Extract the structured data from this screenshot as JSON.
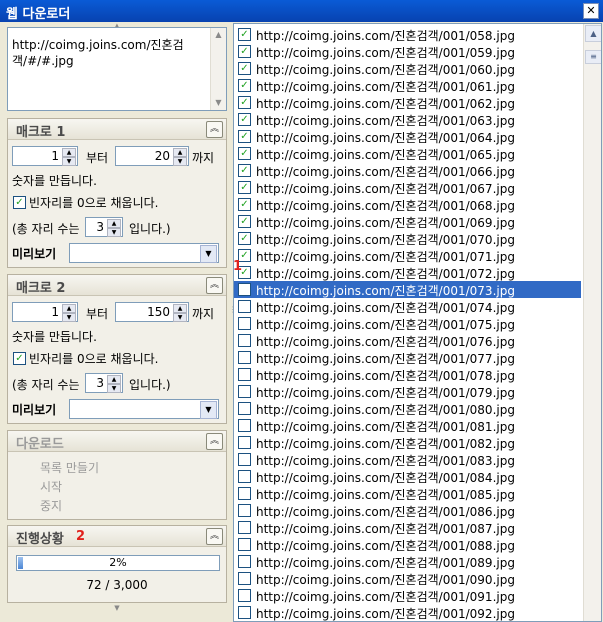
{
  "window": {
    "title": "웹 다운로더",
    "close_glyph": "✕"
  },
  "source": {
    "url_text": "http://coimg.joins.com/진혼검객/#/#.jpg"
  },
  "macro1": {
    "title": "매크로 1",
    "from_value": "1",
    "from_label": "부터",
    "to_value": "20",
    "to_label": "까지",
    "make_label": "숫자를 만듭니다.",
    "zero_fill_label": "빈자리를 0으로 채웁니다.",
    "digits_prefix": "(총 자리 수는",
    "digits_value": "3",
    "digits_suffix": "입니다.)",
    "preview_label": "미리보기"
  },
  "macro2": {
    "title": "매크로 2",
    "from_value": "1",
    "from_label": "부터",
    "to_value": "150",
    "to_label": "까지",
    "make_label": "숫자를 만듭니다.",
    "zero_fill_label": "빈자리를 0으로 채웁니다.",
    "digits_prefix": "(총 자리 수는",
    "digits_value": "3",
    "digits_suffix": "입니다.)",
    "preview_label": "미리보기"
  },
  "download": {
    "title": "다운로드",
    "items": [
      "목록 만들기",
      "시작",
      "중지"
    ]
  },
  "progress": {
    "title": "진행상황",
    "percent_text": "2%",
    "fraction": 0.024,
    "count_text": "72 / 3,000"
  },
  "markers": {
    "first": "1",
    "second": "2"
  },
  "list": {
    "items": [
      {
        "url": "http://coimg.joins.com/진혼검객/001/058.jpg",
        "checked": true
      },
      {
        "url": "http://coimg.joins.com/진혼검객/001/059.jpg",
        "checked": true
      },
      {
        "url": "http://coimg.joins.com/진혼검객/001/060.jpg",
        "checked": true
      },
      {
        "url": "http://coimg.joins.com/진혼검객/001/061.jpg",
        "checked": true
      },
      {
        "url": "http://coimg.joins.com/진혼검객/001/062.jpg",
        "checked": true
      },
      {
        "url": "http://coimg.joins.com/진혼검객/001/063.jpg",
        "checked": true
      },
      {
        "url": "http://coimg.joins.com/진혼검객/001/064.jpg",
        "checked": true
      },
      {
        "url": "http://coimg.joins.com/진혼검객/001/065.jpg",
        "checked": true
      },
      {
        "url": "http://coimg.joins.com/진혼검객/001/066.jpg",
        "checked": true
      },
      {
        "url": "http://coimg.joins.com/진혼검객/001/067.jpg",
        "checked": true
      },
      {
        "url": "http://coimg.joins.com/진혼검객/001/068.jpg",
        "checked": true
      },
      {
        "url": "http://coimg.joins.com/진혼검객/001/069.jpg",
        "checked": true
      },
      {
        "url": "http://coimg.joins.com/진혼검객/001/070.jpg",
        "checked": true
      },
      {
        "url": "http://coimg.joins.com/진혼검객/001/071.jpg",
        "checked": true
      },
      {
        "url": "http://coimg.joins.com/진혼검객/001/072.jpg",
        "checked": true
      },
      {
        "url": "http://coimg.joins.com/진혼검객/001/073.jpg",
        "checked": false,
        "selected": true
      },
      {
        "url": "http://coimg.joins.com/진혼검객/001/074.jpg",
        "checked": false
      },
      {
        "url": "http://coimg.joins.com/진혼검객/001/075.jpg",
        "checked": false
      },
      {
        "url": "http://coimg.joins.com/진혼검객/001/076.jpg",
        "checked": false
      },
      {
        "url": "http://coimg.joins.com/진혼검객/001/077.jpg",
        "checked": false
      },
      {
        "url": "http://coimg.joins.com/진혼검객/001/078.jpg",
        "checked": false
      },
      {
        "url": "http://coimg.joins.com/진혼검객/001/079.jpg",
        "checked": false
      },
      {
        "url": "http://coimg.joins.com/진혼검객/001/080.jpg",
        "checked": false
      },
      {
        "url": "http://coimg.joins.com/진혼검객/001/081.jpg",
        "checked": false
      },
      {
        "url": "http://coimg.joins.com/진혼검객/001/082.jpg",
        "checked": false
      },
      {
        "url": "http://coimg.joins.com/진혼검객/001/083.jpg",
        "checked": false
      },
      {
        "url": "http://coimg.joins.com/진혼검객/001/084.jpg",
        "checked": false
      },
      {
        "url": "http://coimg.joins.com/진혼검객/001/085.jpg",
        "checked": false
      },
      {
        "url": "http://coimg.joins.com/진혼검객/001/086.jpg",
        "checked": false
      },
      {
        "url": "http://coimg.joins.com/진혼검객/001/087.jpg",
        "checked": false
      },
      {
        "url": "http://coimg.joins.com/진혼검객/001/088.jpg",
        "checked": false
      },
      {
        "url": "http://coimg.joins.com/진혼검객/001/089.jpg",
        "checked": false
      },
      {
        "url": "http://coimg.joins.com/진혼검객/001/090.jpg",
        "checked": false
      },
      {
        "url": "http://coimg.joins.com/진혼검객/001/091.jpg",
        "checked": false
      },
      {
        "url": "http://coimg.joins.com/진혼검객/001/092.jpg",
        "checked": false
      }
    ]
  },
  "colors": {
    "selection": "#316ac5",
    "title_bar": "#0a5bd6",
    "marker": "#e0201b",
    "progress_fill": "#4c86d4"
  }
}
